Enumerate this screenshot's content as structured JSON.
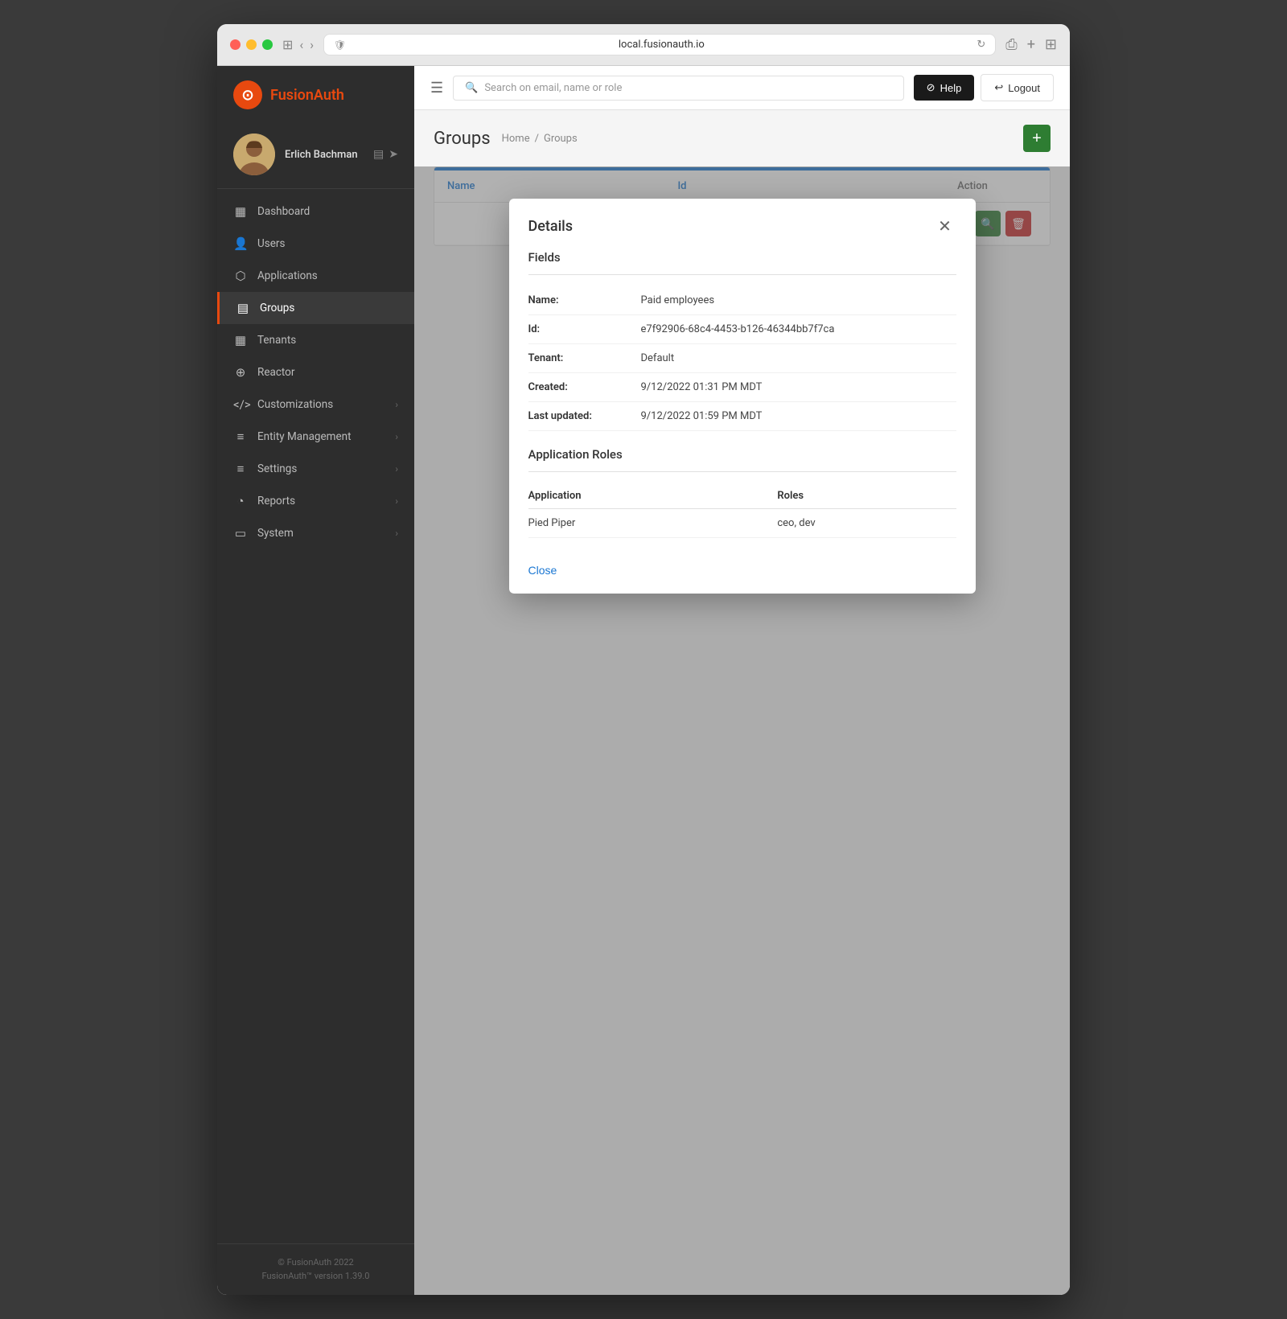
{
  "browser": {
    "url": "local.fusionauth.io",
    "shield_icon": "🛡",
    "reload_icon": "↻"
  },
  "topbar": {
    "search_placeholder": "Search on email, name or role",
    "help_label": "Help",
    "logout_label": "Logout"
  },
  "sidebar": {
    "logo_text_fa": "Fusion",
    "logo_text_auth": "Auth",
    "user_name": "Erlich Bachman",
    "nav_items": [
      {
        "id": "dashboard",
        "label": "Dashboard",
        "icon": "▦",
        "active": false
      },
      {
        "id": "users",
        "label": "Users",
        "icon": "👥",
        "active": false
      },
      {
        "id": "applications",
        "label": "Applications",
        "icon": "⬡",
        "active": false
      },
      {
        "id": "groups",
        "label": "Groups",
        "icon": "▤",
        "active": true
      },
      {
        "id": "tenants",
        "label": "Tenants",
        "icon": "▦",
        "active": false
      },
      {
        "id": "reactor",
        "label": "Reactor",
        "icon": "⊕",
        "active": false
      },
      {
        "id": "customizations",
        "label": "Customizations",
        "icon": "</>",
        "active": false,
        "has_chevron": true
      },
      {
        "id": "entity-management",
        "label": "Entity Management",
        "icon": "≡",
        "active": false,
        "has_chevron": true
      },
      {
        "id": "settings",
        "label": "Settings",
        "icon": "≡",
        "active": false,
        "has_chevron": true
      },
      {
        "id": "reports",
        "label": "Reports",
        "icon": "◔",
        "active": false,
        "has_chevron": true
      },
      {
        "id": "system",
        "label": "System",
        "icon": "▭",
        "active": false,
        "has_chevron": true
      }
    ],
    "footer_line1": "© FusionAuth 2022",
    "footer_line2": "FusionAuth™ version 1.39.0"
  },
  "page": {
    "title": "Groups",
    "breadcrumb_home": "Home",
    "breadcrumb_current": "Groups",
    "add_button_label": "+"
  },
  "table": {
    "columns": [
      {
        "id": "name",
        "label": "Name"
      },
      {
        "id": "id",
        "label": "Id"
      },
      {
        "id": "action",
        "label": "Action"
      }
    ]
  },
  "modal": {
    "title": "Details",
    "fields_section": "Fields",
    "fields": [
      {
        "label": "Name:",
        "value": "Paid employees"
      },
      {
        "label": "Id:",
        "value": "e7f92906-68c4-4453-b126-46344bb7f7ca"
      },
      {
        "label": "Tenant:",
        "value": "Default"
      },
      {
        "label": "Created:",
        "value": "9/12/2022 01:31 PM MDT"
      },
      {
        "label": "Last updated:",
        "value": "9/12/2022 01:59 PM MDT"
      }
    ],
    "app_roles_title": "Application Roles",
    "app_roles_col_app": "Application",
    "app_roles_col_roles": "Roles",
    "app_roles": [
      {
        "application": "Pied Piper",
        "roles": "ceo, dev"
      }
    ],
    "close_label": "Close"
  },
  "colors": {
    "accent_orange": "#e8490f",
    "accent_blue": "#1976d2",
    "accent_green": "#2e7d32",
    "accent_red": "#c62828",
    "sidebar_bg": "#2d2d2d",
    "active_border": "#e8490f"
  }
}
